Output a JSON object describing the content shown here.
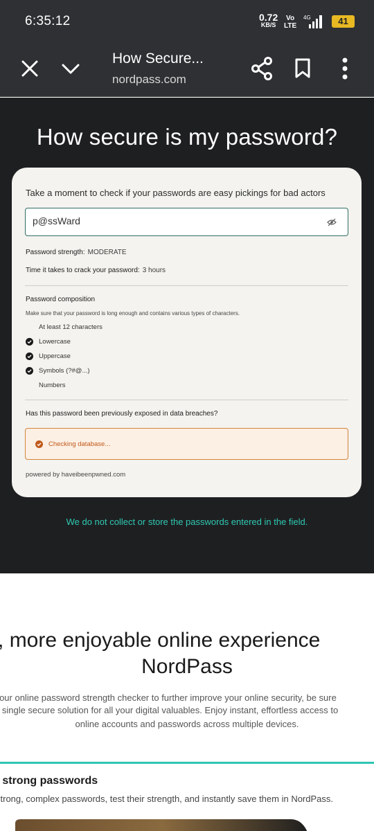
{
  "status_bar": {
    "time": "6:35:12",
    "net_speed": "0.72",
    "net_unit": "KB/S",
    "volte_top": "Vo",
    "volte_bottom": "LTE",
    "network": "4G",
    "battery": "41"
  },
  "toolbar": {
    "title": "How Secure...",
    "url": "nordpass.com",
    "close_icon": "close-icon",
    "chevron_icon": "chevron-down-icon",
    "share_icon": "share-icon",
    "bookmark_icon": "bookmark-icon",
    "more_icon": "more-vertical-icon"
  },
  "hero": {
    "heading": "How secure is my password?",
    "notice": "We do not collect or store the passwords entered in the field."
  },
  "checker": {
    "lead": "Take a moment to check if your passwords are easy pickings for bad actors",
    "password_value": "p@ssWard",
    "strength_label": "Password strength:",
    "strength_value": "MODERATE",
    "crack_label": "Time it takes to crack your password:",
    "crack_value": "3 hours",
    "composition_title": "Password composition",
    "composition_hint": "Make sure that your password is long enough and contains various types of characters.",
    "rules": [
      {
        "label": "At least 12 characters",
        "met": false
      },
      {
        "label": "Lowercase",
        "met": true
      },
      {
        "label": "Uppercase",
        "met": true
      },
      {
        "label": "Symbols (?#@...)",
        "met": true
      },
      {
        "label": "Numbers",
        "met": false
      }
    ],
    "breach_question": "Has this password been previously exposed in data breaches?",
    "breach_status": "Checking database...",
    "powered_by": "powered by haveibeenpwned.com"
  },
  "promo": {
    "heading_line1": "er, more enjoyable online experience",
    "heading_line2": "NordPass",
    "para_line1": "ng our online password strength checker to further improve your online security, be sure",
    "para_line2": "a single secure solution for all your digital valuables. Enjoy instant, effortless access to",
    "para_line3": "online accounts and passwords across multiple devices.",
    "sub_heading": "e strong passwords",
    "sub_text": "strong, complex passwords, test their strength, and instantly save them in NordPass."
  },
  "colors": {
    "accent": "#2fcab3",
    "warning": "#c0591a",
    "dark_bg": "#1e1f21",
    "bar_bg": "#2e3033"
  }
}
